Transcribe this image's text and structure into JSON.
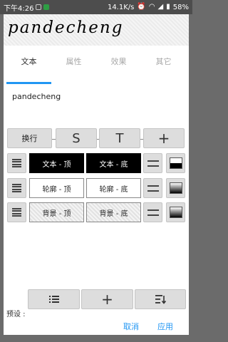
{
  "status_bar": {
    "time": "下午4:26",
    "speed": "14.1K/s",
    "battery": "58%"
  },
  "preview": {
    "text": "pandecheng"
  },
  "tabs": [
    {
      "label": "文本",
      "active": true
    },
    {
      "label": "属性",
      "active": false
    },
    {
      "label": "效果",
      "active": false
    },
    {
      "label": "其它",
      "active": false
    }
  ],
  "text_input": {
    "value": "pandecheng"
  },
  "toolbar": {
    "wrap_label": "换行",
    "s_label": "S",
    "t_label": "T",
    "plus_label": "+"
  },
  "rows": {
    "text": {
      "top_label": "文本 - 顶",
      "bottom_label": "文本 - 底"
    },
    "outline": {
      "top_label": "轮廓 - 顶",
      "bottom_label": "轮廓 - 底"
    },
    "background": {
      "top_label": "背景 - 顶",
      "bottom_label": "背景 - 底"
    }
  },
  "presets": {
    "label": "预设 :",
    "add_label": "+"
  },
  "actions": {
    "cancel_label": "取消",
    "apply_label": "应用"
  },
  "colors": {
    "accent": "#2196f3",
    "button_bg": "#dddddd",
    "overlay": "#6b6b6b"
  },
  "icons": [
    "lines-icon",
    "equals-icon",
    "gradient-icon",
    "list-icon",
    "plus-icon",
    "sort-icon"
  ]
}
